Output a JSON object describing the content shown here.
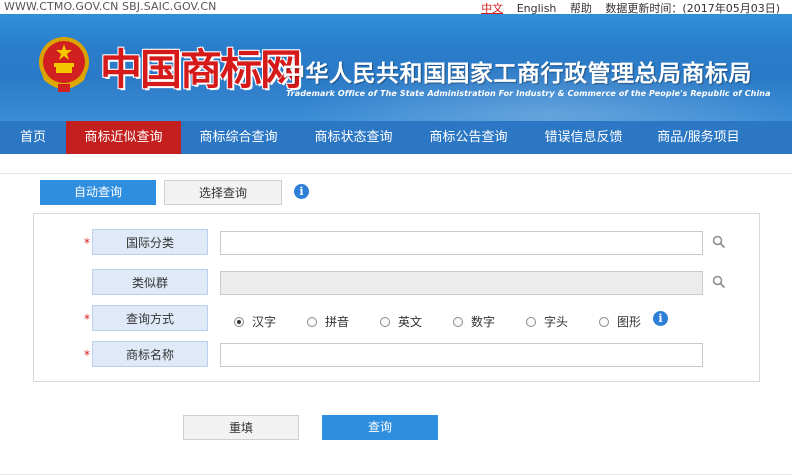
{
  "topbar": {
    "sites": "WWW.CTMO.GOV.CN SBJ.SAIC.GOV.CN",
    "lang_zh": "中文",
    "lang_en": "English",
    "help": "帮助",
    "update_time": "数据更新时间：(2017年05月03日)"
  },
  "header": {
    "logo_text": "中国商标网",
    "bureau_name": "中华人民共和国国家工商行政管理总局商标局",
    "bureau_en": "Trademark Office of The State Administration For Industry & Commerce of the People's Republic of China"
  },
  "nav": {
    "items": [
      {
        "label": "首页"
      },
      {
        "label": "商标近似查询"
      },
      {
        "label": "商标综合查询"
      },
      {
        "label": "商标状态查询"
      },
      {
        "label": "商标公告查询"
      },
      {
        "label": "错误信息反馈"
      },
      {
        "label": "商品/服务项目"
      }
    ],
    "active_index": 1
  },
  "tabs": {
    "auto": "自动查询",
    "select": "选择查询"
  },
  "form": {
    "required_mark": "*",
    "intl_class_label": "国际分类",
    "intl_class_value": "",
    "similar_group_label": "类似群",
    "similar_group_value": "",
    "query_method_label": "查询方式",
    "trademark_name_label": "商标名称",
    "trademark_name_value": "",
    "query_methods": [
      {
        "label": "汉字",
        "checked": true
      },
      {
        "label": "拼音",
        "checked": false
      },
      {
        "label": "英文",
        "checked": false
      },
      {
        "label": "数字",
        "checked": false
      },
      {
        "label": "字头",
        "checked": false
      },
      {
        "label": "图形",
        "checked": false
      }
    ]
  },
  "buttons": {
    "reset": "重填",
    "query": "查询"
  },
  "colors": {
    "nav_bg": "#2c77c4",
    "nav_active": "#c41f1f",
    "primary_button": "#2e8ee0",
    "label_bg": "#dfe9f7",
    "required": "#d51b1b"
  },
  "icons": {
    "info": "info-icon",
    "search": "search-icon",
    "emblem": "national-emblem-icon"
  }
}
